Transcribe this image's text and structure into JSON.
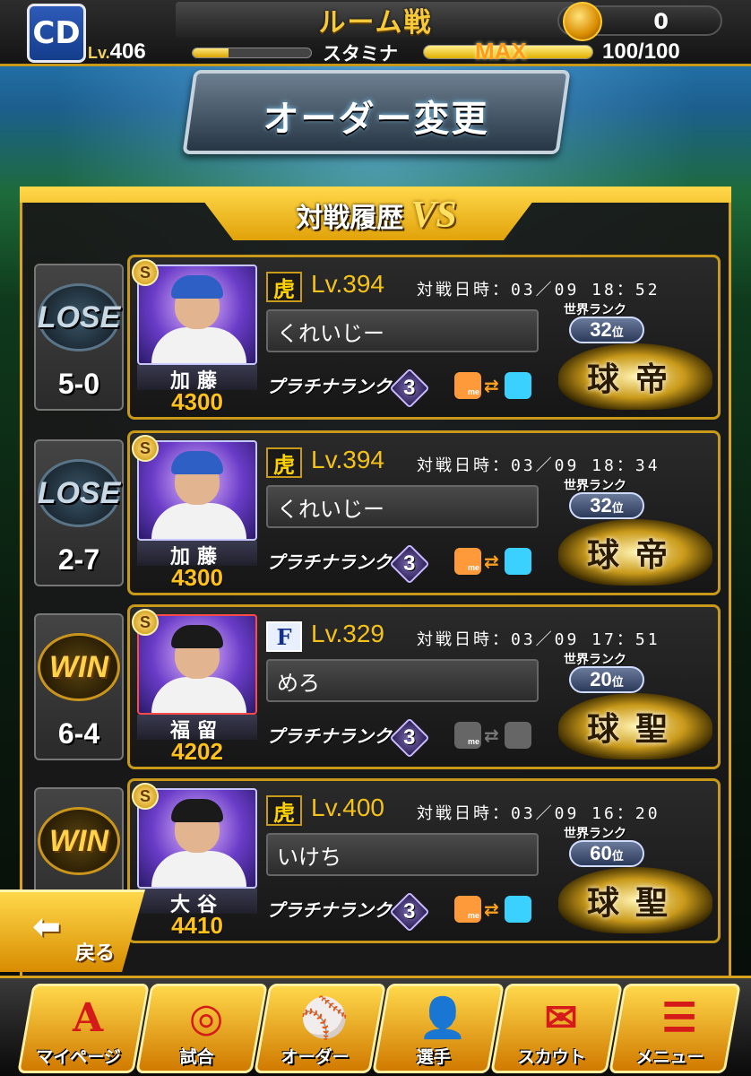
{
  "header": {
    "title": "ルーム戦",
    "level_prefix": "Lv.",
    "level": "406",
    "stamina_label": "スタミナ",
    "stamina_max": "MAX",
    "stamina_value": "100/100",
    "stamina_fraction": 1.0,
    "exp_fraction": 0.3,
    "coins": "0",
    "team_logo": "CD"
  },
  "screen_title": "オーダー変更",
  "history": {
    "title": "対戦履歴",
    "vs": "VS"
  },
  "matches": [
    {
      "result": "LOSE",
      "score": "5-0",
      "srank": "S",
      "player_name": "加藤",
      "player_power": "4300",
      "opp_team": "虎",
      "opp_level": "Lv.394",
      "date": "対戦日時：03／09 18：52",
      "opp_name": "くれいじー",
      "rank_class": "プラチナランク",
      "rank_num": "3",
      "friend_active": true,
      "world_rank_label": "世界ランク",
      "world_rank": "32",
      "rank_suffix": "位",
      "title_emblem": "球帝"
    },
    {
      "result": "LOSE",
      "score": "2-7",
      "srank": "S",
      "player_name": "加藤",
      "player_power": "4300",
      "opp_team": "虎",
      "opp_level": "Lv.394",
      "date": "対戦日時：03／09 18：34",
      "opp_name": "くれいじー",
      "rank_class": "プラチナランク",
      "rank_num": "3",
      "friend_active": true,
      "world_rank_label": "世界ランク",
      "world_rank": "32",
      "rank_suffix": "位",
      "title_emblem": "球帝"
    },
    {
      "result": "WIN",
      "score": "6-4",
      "srank": "S",
      "player_name": "福留",
      "player_power": "4202",
      "opp_team": "F",
      "opp_level": "Lv.329",
      "date": "対戦日時：03／09 17：51",
      "opp_name": "めろ",
      "rank_class": "プラチナランク",
      "rank_num": "3",
      "friend_active": false,
      "world_rank_label": "世界ランク",
      "world_rank": "20",
      "rank_suffix": "位",
      "title_emblem": "球聖"
    },
    {
      "result": "WIN",
      "score": "",
      "srank": "S",
      "player_name": "大谷",
      "player_power": "4410",
      "opp_team": "虎",
      "opp_level": "Lv.400",
      "date": "対戦日時：03／09 16：20",
      "opp_name": "いけち",
      "rank_class": "プラチナランク",
      "rank_num": "3",
      "friend_active": true,
      "world_rank_label": "世界ランク",
      "world_rank": "60",
      "rank_suffix": "位",
      "title_emblem": "球聖"
    }
  ],
  "back_label": "戻る",
  "nav": [
    {
      "label": "マイページ",
      "icon": "a-logo-icon"
    },
    {
      "label": "試合",
      "icon": "stadium-icon"
    },
    {
      "label": "オーダー",
      "icon": "field-icon"
    },
    {
      "label": "選手",
      "icon": "player-icon"
    },
    {
      "label": "スカウト",
      "icon": "scout-icon"
    },
    {
      "label": "メニュー",
      "icon": "menu-icon"
    }
  ],
  "colors": {
    "accent": "#d8a21a",
    "power": "#ffc21a",
    "level": "#f5c21a",
    "stamina_max": "#ff9a1a"
  }
}
